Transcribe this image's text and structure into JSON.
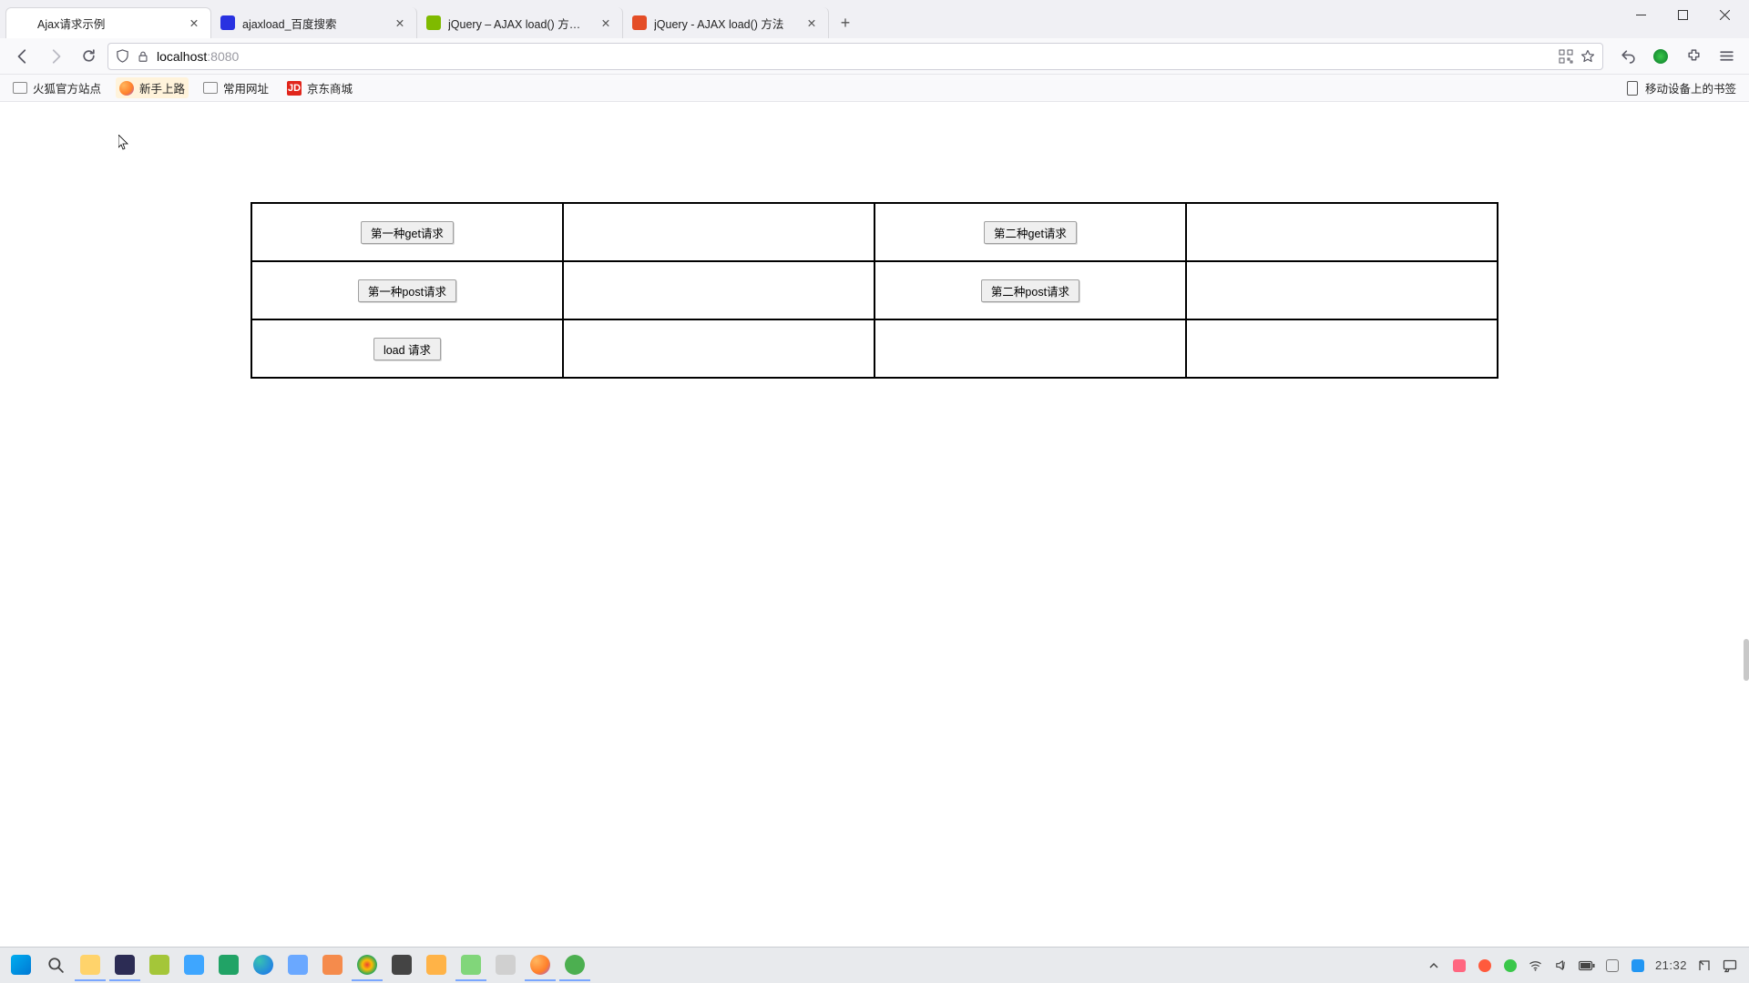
{
  "window_controls": {
    "min": "–",
    "max": "❐",
    "close": "✕"
  },
  "tabs": [
    {
      "title": "Ajax请求示例",
      "favicon": ""
    },
    {
      "title": "ajaxload_百度搜索",
      "favicon": "baidu"
    },
    {
      "title": "jQuery – AJAX load() 方法 | 菜",
      "favicon": "runoob"
    },
    {
      "title": "jQuery - AJAX load() 方法",
      "favicon": "w3c"
    }
  ],
  "url": {
    "host": "localhost",
    "port": ":8080"
  },
  "bookmarks": {
    "items": [
      {
        "label": "火狐官方站点",
        "icon": "folder"
      },
      {
        "label": "新手上路",
        "icon": "ff"
      },
      {
        "label": "常用网址",
        "icon": "folder"
      },
      {
        "label": "京东商城",
        "icon": "jd"
      }
    ],
    "overflow": "移动设备上的书签"
  },
  "page": {
    "buttons": {
      "r1c1": "第一种get请求",
      "r1c3": "第二种get请求",
      "r2c1": "第一种post请求",
      "r2c3": "第二种post请求",
      "r3c1": "load 请求"
    }
  },
  "tray": {
    "time": "21:32"
  }
}
